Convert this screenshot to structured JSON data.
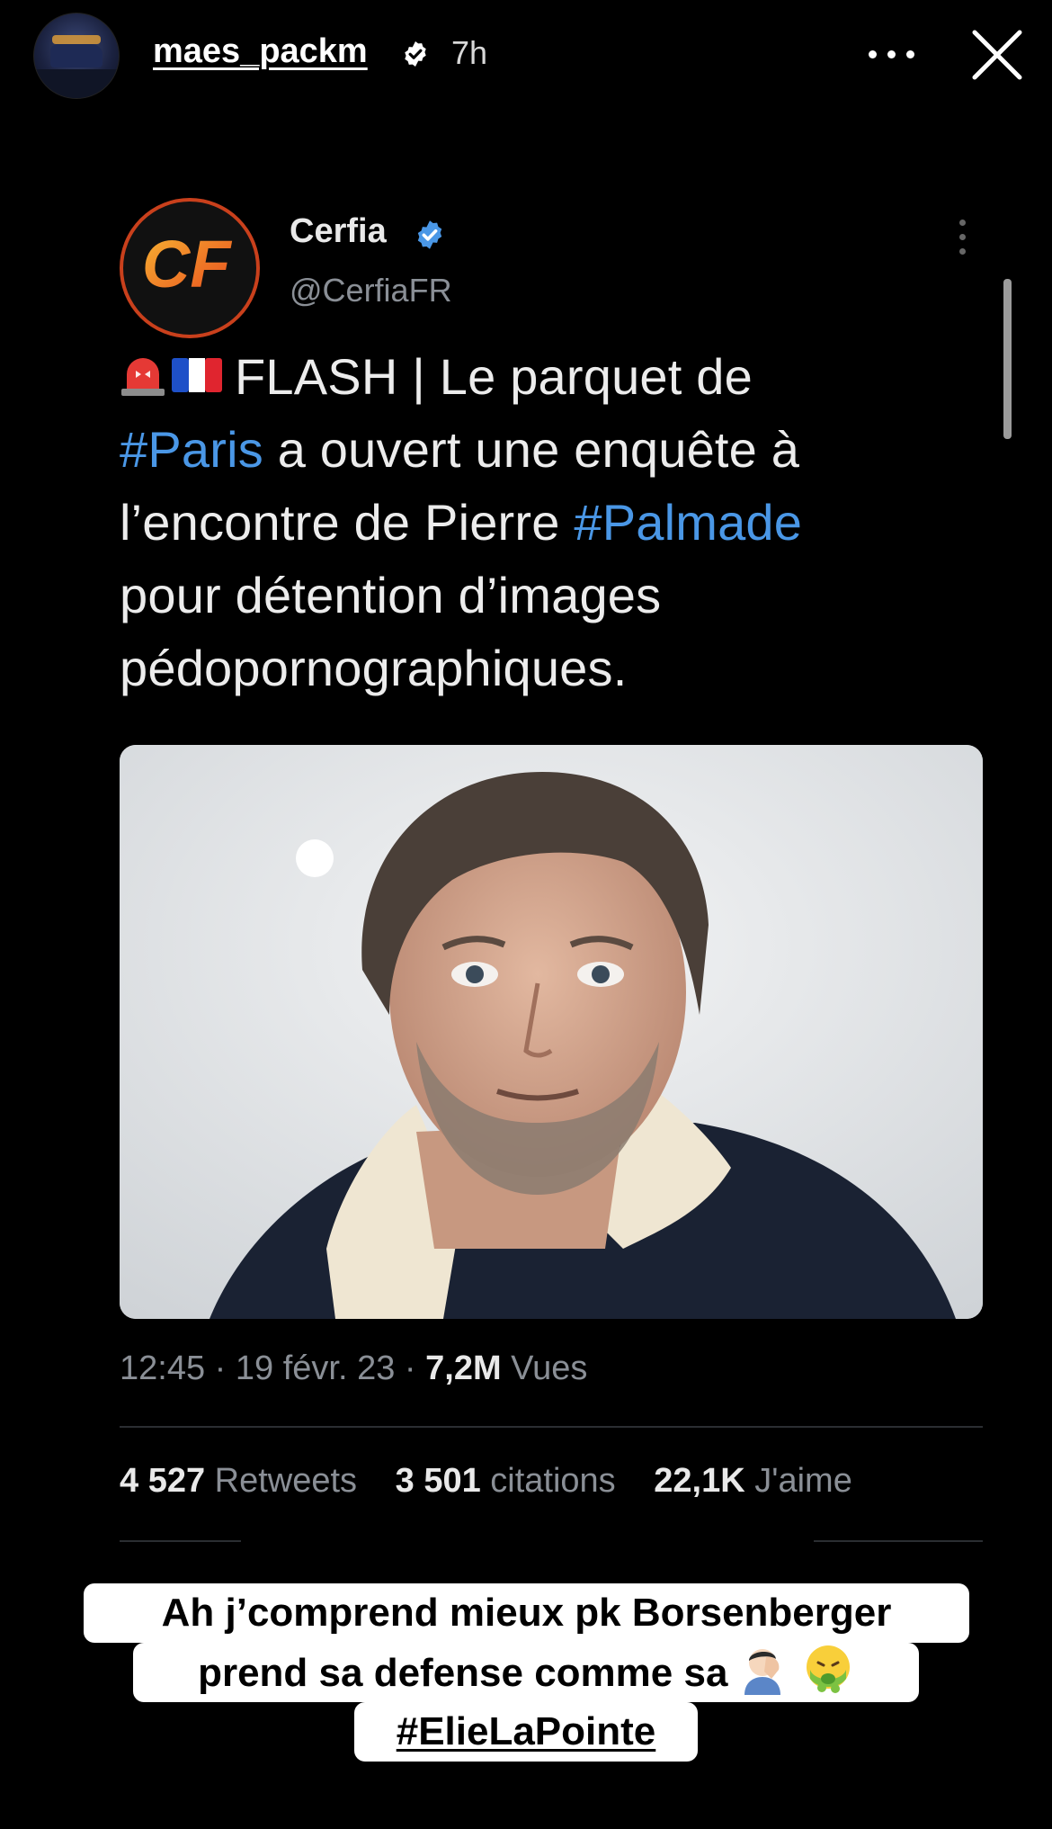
{
  "story": {
    "username": "maes_packm",
    "time_ago": "7h",
    "icons": {
      "verified": "verified-badge-icon",
      "more": "more-horizontal-icon",
      "close": "close-icon"
    }
  },
  "tweet": {
    "author_name": "Cerfia",
    "author_handle": "@CerfiaFR",
    "logo_text": "CF",
    "text": {
      "line1": "FLASH | Le parquet de",
      "line2_tag": "#Paris",
      "line2_rest": " a ouvert une enquête à",
      "line3_start": "l’encontre de Pierre ",
      "line3_tag": "#Palmade",
      "line4": "pour détention d’images",
      "line5": "pédopornographiques."
    },
    "time": "12:45",
    "date": "19 févr. 23",
    "views_count": "7,2M",
    "views_label": "Vues",
    "retweets_count": "4 527",
    "retweets_label": "Retweets",
    "quotes_count": "3 501",
    "quotes_label": "citations",
    "likes_count": "22,1K",
    "likes_label": "J'aime",
    "accent_color": "#4a97e6"
  },
  "caption": {
    "line1": "Ah j’comprend mieux pk Borsenberger",
    "line2": "prend sa defense comme sa",
    "line3": "#ElieLaPointe",
    "emojis": [
      "facepalm-emoji",
      "nauseated-face-emoji"
    ]
  },
  "separator": " · "
}
